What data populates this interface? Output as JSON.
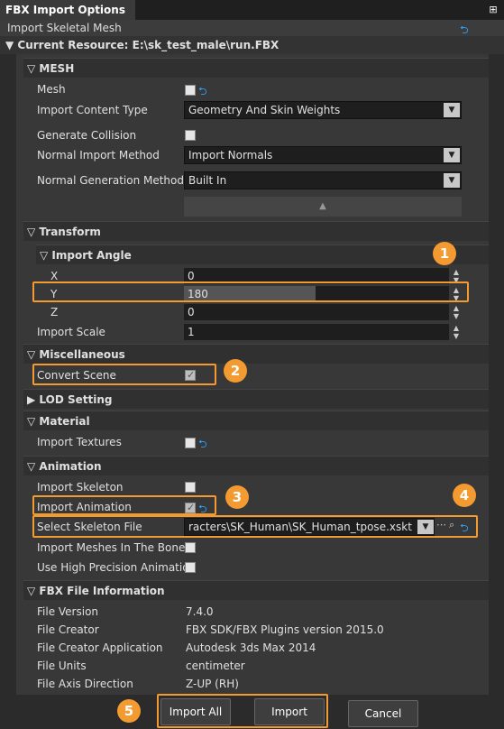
{
  "window": {
    "title": "FBX Import Options",
    "subtitle": "Import Skeletal Mesh"
  },
  "resource": {
    "label": "Current Resource: E:\\sk_test_male\\run.FBX"
  },
  "mesh": {
    "header": "MESH",
    "mesh_label": "Mesh",
    "content_type_label": "Import Content Type",
    "content_type_value": "Geometry And Skin Weights",
    "generate_collision_label": "Generate Collision",
    "normal_import_label": "Normal Import Method",
    "normal_import_value": "Import Normals",
    "normal_gen_label": "Normal Generation Method",
    "normal_gen_value": "Built In"
  },
  "transform": {
    "header": "Transform",
    "import_angle_header": "Import Angle",
    "x_label": "X",
    "x_value": "0",
    "y_label": "Y",
    "y_value": "180",
    "z_label": "Z",
    "z_value": "0",
    "scale_label": "Import Scale",
    "scale_value": "1"
  },
  "misc": {
    "header": "Miscellaneous",
    "convert_scene_label": "Convert Scene"
  },
  "lod": {
    "header": "LOD Setting"
  },
  "material": {
    "header": "Material",
    "import_textures_label": "Import Textures"
  },
  "animation": {
    "header": "Animation",
    "import_skeleton_label": "Import Skeleton",
    "import_animation_label": "Import Animation",
    "select_skeleton_label": "Select Skeleton File",
    "select_skeleton_value": "racters\\SK_Human\\SK_Human_tpose.xskt",
    "meshes_in_bone_label": "Import Meshes In The Bone",
    "high_precision_label": "Use High Precision Animation"
  },
  "fbx_info": {
    "header": "FBX File Information",
    "rows": [
      {
        "label": "File Version",
        "value": "7.4.0"
      },
      {
        "label": "File Creator",
        "value": "FBX SDK/FBX Plugins version 2015.0"
      },
      {
        "label": "File Creator Application",
        "value": "Autodesk 3ds Max 2014"
      },
      {
        "label": "File Units",
        "value": "centimeter"
      },
      {
        "label": "File Axis Direction",
        "value": "Z-UP (RH)"
      }
    ]
  },
  "buttons": {
    "import_all": "Import All",
    "import": "Import",
    "cancel": "Cancel"
  },
  "badges": [
    "1",
    "2",
    "3",
    "4",
    "5"
  ],
  "colors": {
    "highlight": "#f39a30",
    "reset_icon": "#2aa4ff"
  }
}
